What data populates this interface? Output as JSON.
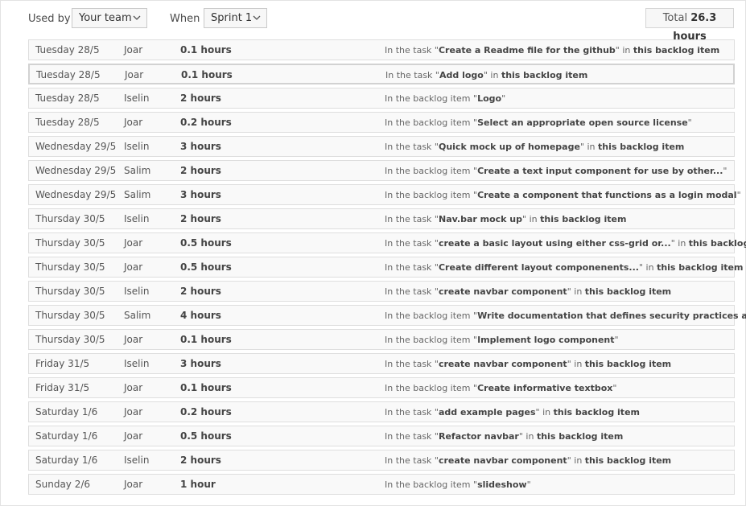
{
  "toolbar": {
    "used_by_label": "Used by",
    "used_by_value": "Your team",
    "when_label": "When",
    "when_value": "Sprint 1",
    "total_label": "Total",
    "total_value": "26.3 hours"
  },
  "rows": [
    {
      "date": "Tuesday 28/5",
      "user": "Joar",
      "hours": "0.1 hours",
      "prefix": "In the task \"",
      "title": "Create a Readme file for the github",
      "suffix": "\" in ",
      "link": "this backlog item"
    },
    {
      "date": "Tuesday 28/5",
      "user": "Joar",
      "hours": "0.1 hours",
      "prefix": "In the task \"",
      "title": "Add logo",
      "suffix": "\" in ",
      "link": "this backlog item"
    },
    {
      "date": "Tuesday 28/5",
      "user": "Iselin",
      "hours": "2 hours",
      "prefix": "In the backlog item \"",
      "title": "Logo",
      "suffix": "\"",
      "link": ""
    },
    {
      "date": "Tuesday 28/5",
      "user": "Joar",
      "hours": "0.2 hours",
      "prefix": "In the backlog item \"",
      "title": "Select an appropriate open source license",
      "suffix": "\"",
      "link": ""
    },
    {
      "date": "Wednesday 29/5",
      "user": "Iselin",
      "hours": "3 hours",
      "prefix": "In the task \"",
      "title": "Quick mock up of homepage",
      "suffix": "\" in ",
      "link": "this backlog item"
    },
    {
      "date": "Wednesday 29/5",
      "user": "Salim",
      "hours": "2 hours",
      "prefix": "In the backlog item \"",
      "title": "Create a text input component for use by other...",
      "suffix": "\"",
      "link": ""
    },
    {
      "date": "Wednesday 29/5",
      "user": "Salim",
      "hours": "3 hours",
      "prefix": "In the backlog item \"",
      "title": "Create a component that functions as a login modal",
      "suffix": "\"",
      "link": ""
    },
    {
      "date": "Thursday 30/5",
      "user": "Iselin",
      "hours": "2 hours",
      "prefix": "In the task \"",
      "title": "Nav.bar mock up",
      "suffix": "\" in ",
      "link": "this backlog item"
    },
    {
      "date": "Thursday 30/5",
      "user": "Joar",
      "hours": "0.5 hours",
      "prefix": "In the task \"",
      "title": "create a basic layout using either css-grid or...",
      "suffix": "\" in ",
      "link": "this backlog item"
    },
    {
      "date": "Thursday 30/5",
      "user": "Joar",
      "hours": "0.5 hours",
      "prefix": "In the task \"",
      "title": "Create different layout componenents...",
      "suffix": "\" in ",
      "link": "this backlog item"
    },
    {
      "date": "Thursday 30/5",
      "user": "Iselin",
      "hours": "2 hours",
      "prefix": "In the task \"",
      "title": "create navbar component",
      "suffix": "\" in ",
      "link": "this backlog item"
    },
    {
      "date": "Thursday 30/5",
      "user": "Salim",
      "hours": "4 hours",
      "prefix": "In the backlog item \"",
      "title": "Write documentation that defines security practices and...",
      "suffix": "\"",
      "link": ""
    },
    {
      "date": "Thursday 30/5",
      "user": "Joar",
      "hours": "0.1 hours",
      "prefix": "In the backlog item \"",
      "title": "Implement logo component",
      "suffix": "\"",
      "link": ""
    },
    {
      "date": "Friday 31/5",
      "user": "Iselin",
      "hours": "3 hours",
      "prefix": "In the task \"",
      "title": "create navbar component",
      "suffix": "\" in ",
      "link": "this backlog item"
    },
    {
      "date": "Friday 31/5",
      "user": "Joar",
      "hours": "0.1 hours",
      "prefix": "In the backlog item \"",
      "title": "Create informative textbox",
      "suffix": "\"",
      "link": ""
    },
    {
      "date": "Saturday 1/6",
      "user": "Joar",
      "hours": "0.2 hours",
      "prefix": "In the task \"",
      "title": "add example pages",
      "suffix": "\" in ",
      "link": "this backlog item"
    },
    {
      "date": "Saturday 1/6",
      "user": "Joar",
      "hours": "0.5 hours",
      "prefix": "In the task \"",
      "title": "Refactor navbar",
      "suffix": "\" in ",
      "link": "this backlog item"
    },
    {
      "date": "Saturday 1/6",
      "user": "Iselin",
      "hours": "2 hours",
      "prefix": "In the task \"",
      "title": "create navbar component",
      "suffix": "\" in ",
      "link": "this backlog item"
    },
    {
      "date": "Sunday 2/6",
      "user": "Joar",
      "hours": "1 hour",
      "prefix": "In the backlog item \"",
      "title": "slideshow",
      "suffix": "\"",
      "link": ""
    }
  ]
}
